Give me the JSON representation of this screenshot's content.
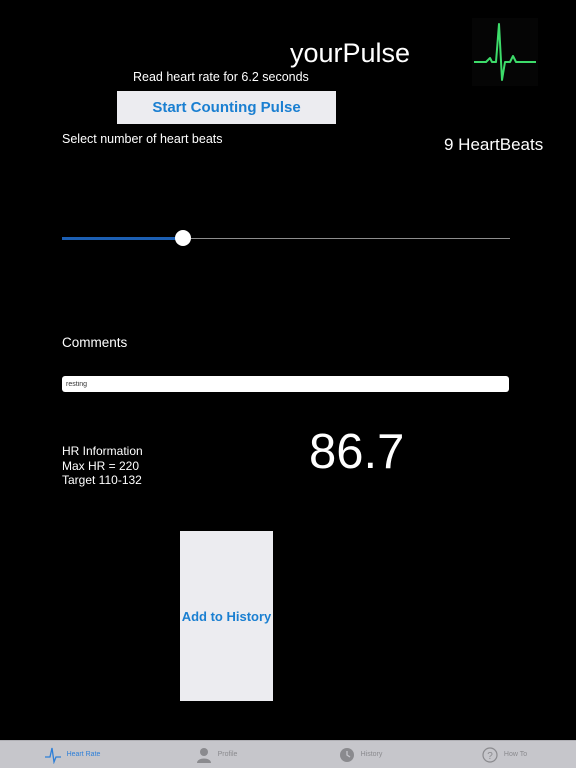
{
  "app": {
    "title": "yourPulse"
  },
  "counter": {
    "read_rate": "Read heart rate for 6.2 seconds",
    "start_label": "Start Counting Pulse",
    "select_label": "Select number of heart beats",
    "beats_label": "9 HeartBeats",
    "slider_fraction": 0.27
  },
  "comments": {
    "label": "Comments",
    "value": "resting"
  },
  "hr_info": {
    "heading": "HR Information",
    "max_hr": "Max HR = 220",
    "target": "Target 110-132",
    "value": "86.7"
  },
  "actions": {
    "add_label": "Add to History"
  },
  "tabbar": {
    "tabs": [
      {
        "label": "Heart Rate",
        "icon": "heartbeat-icon",
        "active": true
      },
      {
        "label": "Profile",
        "icon": "person-icon",
        "active": false
      },
      {
        "label": "History",
        "icon": "clock-icon",
        "active": false
      },
      {
        "label": "How To",
        "icon": "question-icon",
        "active": false
      }
    ]
  },
  "colors": {
    "accent": "#1a7fd1",
    "slider_fill": "#1c5fb3",
    "logo_green": "#3ddc6a",
    "tabbar_bg": "#c6c6cb"
  }
}
